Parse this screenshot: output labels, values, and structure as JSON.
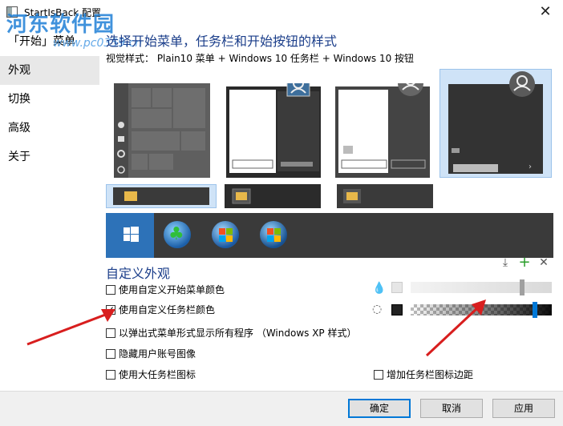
{
  "window": {
    "title": "StartIsBack 配置",
    "close_symbol": "✕"
  },
  "watermark": {
    "text": "河东软件园",
    "url": "www.pc0359.cn"
  },
  "sidebar": {
    "items": [
      {
        "label": "「开始」菜单"
      },
      {
        "label": "外观"
      },
      {
        "label": "切换"
      },
      {
        "label": "高级"
      },
      {
        "label": "关于"
      }
    ]
  },
  "main": {
    "section_title": "选择开始菜单，任务栏和开始按钮的样式",
    "visual_style": "视觉样式：  Plain10 菜单 + Windows 10 任务栏 + Windows 10 按钮"
  },
  "customize": {
    "title": "自定义外观",
    "icons": [
      "download-icon",
      "plus-icon",
      "close-icon"
    ],
    "options": [
      {
        "label": "使用自定义开始菜单颜色",
        "checked": false
      },
      {
        "label": "使用自定义任务栏颜色",
        "checked": true
      },
      {
        "label": "以弹出式菜单形式显示所有程序 （Windows XP 样式）",
        "checked": false
      },
      {
        "label": "隐藏用户账号图像",
        "checked": false
      },
      {
        "label": "使用大任务栏图标",
        "checked": false
      },
      {
        "label": "增加任务栏图标边距",
        "checked": false
      }
    ]
  },
  "footer": {
    "ok": "确定",
    "cancel": "取消",
    "apply": "应用"
  },
  "colors": {
    "accent": "#0078d7",
    "title_blue": "#1b3e8a",
    "selection": "#cfe3f7",
    "annotation": "#d81e1e"
  }
}
